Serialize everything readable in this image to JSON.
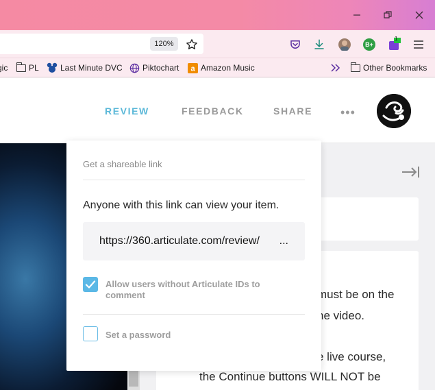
{
  "browser": {
    "zoom": "120%",
    "extension_badge": "1",
    "profile_badge": "B+",
    "bookmarks": [
      {
        "label": "gic",
        "icon": "none"
      },
      {
        "label": "PL",
        "icon": "folder-icon"
      },
      {
        "label": "Last Minute DVC",
        "icon": "mickey-icon"
      },
      {
        "label": "Piktochart",
        "icon": "globe-icon"
      },
      {
        "label": "Amazon Music",
        "icon": "amazon-icon"
      }
    ],
    "other_bookmarks": "Other Bookmarks"
  },
  "header": {
    "tabs": {
      "review": "REVIEW",
      "feedback": "FEEDBACK",
      "share": "SHARE"
    },
    "more": "•••",
    "active_tab": "review"
  },
  "share_popup": {
    "heading": "Get a shareable link",
    "description": "Anyone with this link can view your item.",
    "link": "https://360.articulate.com/review/",
    "link_ellipsis": "...",
    "allow_comments": {
      "label_line1": "Allow users without Articulate IDs to",
      "label_line2": "comment",
      "checked": true
    },
    "password": {
      "label": "Set a password",
      "checked": false
    }
  },
  "content": {
    "lines": [
      "must be on the",
      "ne video.",
      "e live course,",
      "the Continue buttons WILL NOT be"
    ]
  },
  "colors": {
    "accent": "#5bb8d8",
    "checkbox": "#5bb8e6",
    "titlebar_start": "#f58aa3",
    "titlebar_end": "#d77ed3"
  }
}
